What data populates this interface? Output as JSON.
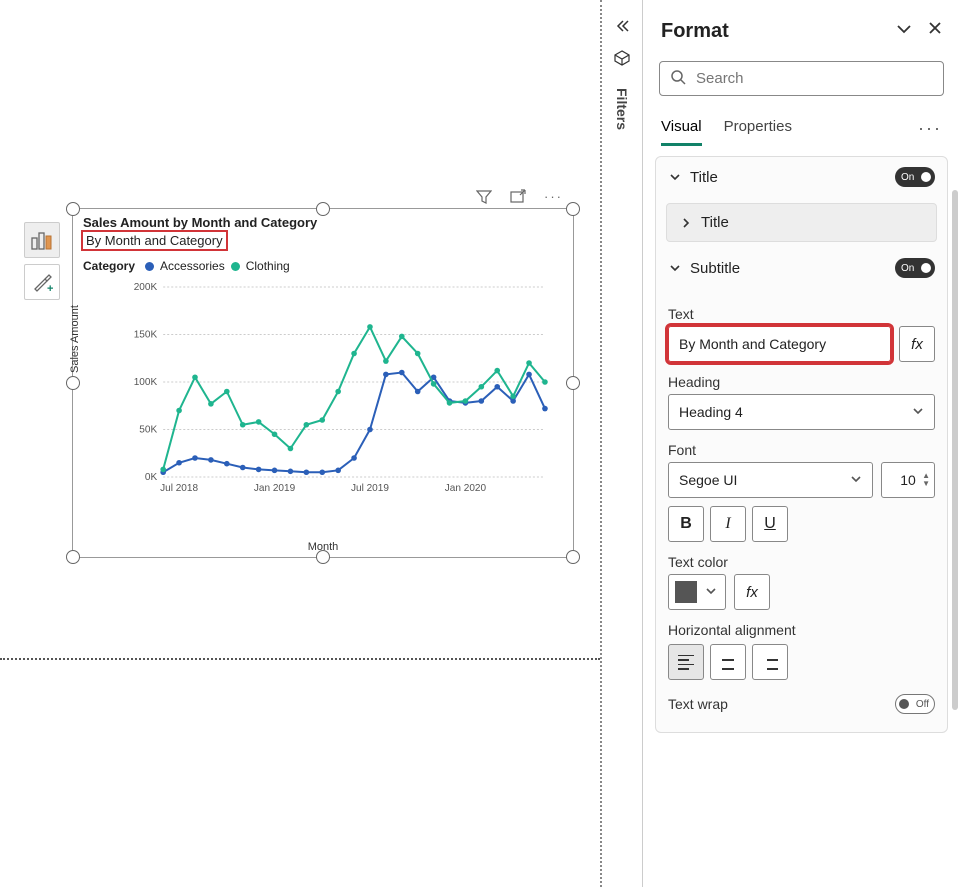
{
  "chart": {
    "title": "Sales Amount by Month and Category",
    "subtitle": "By Month and Category",
    "legend_label": "Category",
    "series_names": {
      "a": "Accessories",
      "c": "Clothing"
    },
    "y_axis_label": "Sales Amount",
    "x_axis_label": "Month",
    "y_ticks": [
      "0K",
      "50K",
      "100K",
      "150K",
      "200K"
    ],
    "x_ticks": [
      "Jul 2018",
      "Jan 2019",
      "Jul 2019",
      "Jan 2020"
    ]
  },
  "chart_data": {
    "type": "line",
    "xlabel": "Month",
    "ylabel": "Sales Amount",
    "ylim": [
      0,
      200000
    ],
    "x": [
      "2018-06",
      "2018-07",
      "2018-08",
      "2018-09",
      "2018-10",
      "2018-11",
      "2018-12",
      "2019-01",
      "2019-02",
      "2019-03",
      "2019-04",
      "2019-05",
      "2019-06",
      "2019-07",
      "2019-08",
      "2019-09",
      "2019-10",
      "2019-11",
      "2019-12",
      "2020-01",
      "2020-02",
      "2020-03",
      "2020-04",
      "2020-05",
      "2020-06"
    ],
    "series": [
      {
        "name": "Accessories",
        "color": "#2b5fb8",
        "values": [
          5000,
          15000,
          20000,
          18000,
          14000,
          10000,
          8000,
          7000,
          6000,
          5000,
          5000,
          7000,
          20000,
          50000,
          108000,
          110000,
          90000,
          105000,
          80000,
          78000,
          80000,
          95000,
          80000,
          108000,
          72000
        ]
      },
      {
        "name": "Clothing",
        "color": "#1fb58f",
        "values": [
          8000,
          70000,
          105000,
          77000,
          90000,
          55000,
          58000,
          45000,
          30000,
          55000,
          60000,
          90000,
          130000,
          158000,
          122000,
          148000,
          130000,
          98000,
          78000,
          80000,
          95000,
          112000,
          85000,
          120000,
          100000
        ]
      }
    ],
    "title": "Sales Amount by Month and Category"
  },
  "filters_label": "Filters",
  "format_panel": {
    "title": "Format",
    "search_placeholder": "Search",
    "tabs": {
      "visual": "Visual",
      "properties": "Properties"
    },
    "sections": {
      "title_section": {
        "label": "Title",
        "toggle": "On",
        "sub_label": "Title"
      },
      "subtitle_section": {
        "label": "Subtitle",
        "toggle": "On",
        "text_label": "Text",
        "text_value": "By Month and Category",
        "heading_label": "Heading",
        "heading_value": "Heading 4",
        "font_label": "Font",
        "font_value": "Segoe UI",
        "font_size": "10",
        "bold": "B",
        "italic": "I",
        "underline": "U",
        "text_color_label": "Text color",
        "align_label": "Horizontal alignment",
        "wrap_label": "Text wrap",
        "wrap_toggle": "Off",
        "fx": "fx"
      }
    }
  }
}
